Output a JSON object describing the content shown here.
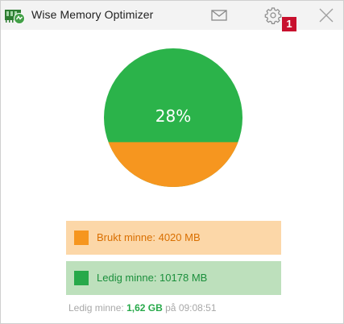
{
  "app": {
    "title": "Wise Memory Optimizer",
    "icon": "memory-chip-icon"
  },
  "titlebar": {
    "mail_icon": "mail-icon",
    "settings_icon": "gear-icon",
    "close_icon": "close-icon",
    "badge": "1"
  },
  "pie": {
    "used_percent": 28,
    "label": "28%",
    "colors": {
      "used": "#f6961f",
      "free": "#2bb34a"
    }
  },
  "legend": {
    "used": "Brukt minne: 4020 MB",
    "free": "Ledig minne: 10178 MB"
  },
  "status": {
    "label": "Ledig minne:",
    "amount": "1,62 GB",
    "on": "på",
    "time": "09:08:51"
  },
  "colors": {
    "accent_green": "#27a94a",
    "accent_orange": "#f6961f",
    "badge_red": "#c8102e"
  }
}
